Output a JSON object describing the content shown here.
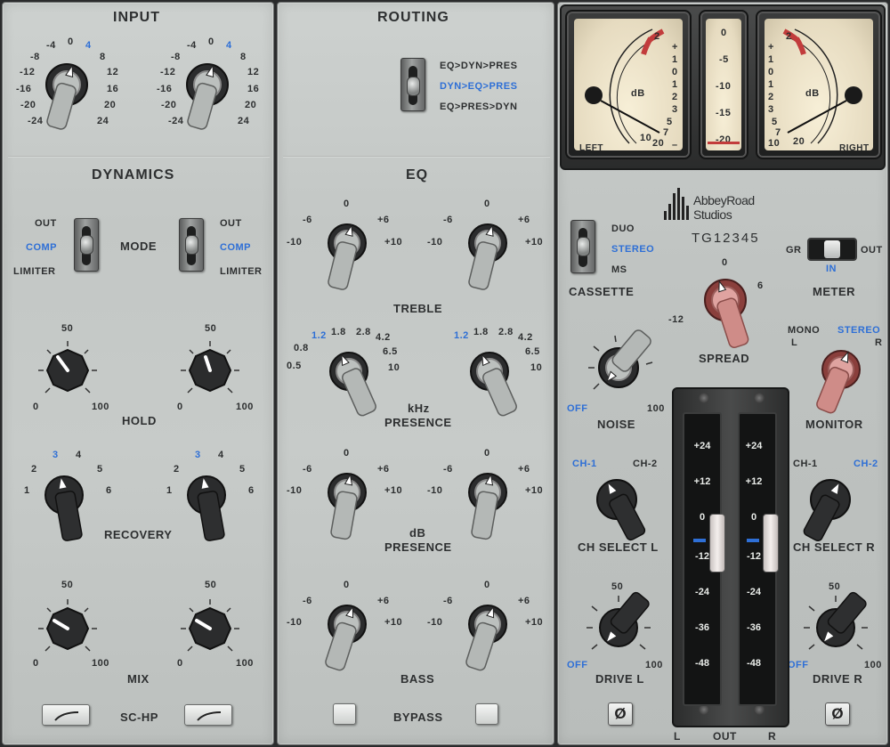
{
  "sections": {
    "input": "INPUT",
    "routing": "ROUTING",
    "dynamics": "DYNAMICS",
    "eq": "EQ"
  },
  "input_scale": {
    "left": [
      "-24",
      "-20",
      "-16",
      "-12",
      "-8",
      "-4",
      "0",
      "4",
      "8",
      "12",
      "16",
      "20",
      "24"
    ],
    "selected": "4"
  },
  "routing": {
    "options": [
      "EQ>DYN>PRES",
      "DYN>EQ>PRES",
      "EQ>PRES>DYN"
    ],
    "selected": "DYN>EQ>PRES"
  },
  "dynamics": {
    "mode_label": "MODE",
    "mode_options": [
      "OUT",
      "COMP",
      "LIMITER"
    ],
    "mode_selected": "COMP",
    "hold_label": "HOLD",
    "hold_scale": [
      "0",
      "50",
      "100"
    ],
    "recovery_label": "RECOVERY",
    "recovery_scale": [
      "1",
      "2",
      "3",
      "4",
      "5",
      "6"
    ],
    "recovery_selected": "3",
    "mix_label": "MIX",
    "mix_scale": [
      "0",
      "50",
      "100"
    ],
    "schp_label": "SC-HP"
  },
  "eq": {
    "treble_label": "TREBLE",
    "gain_scale": [
      "-10",
      "-6",
      "0",
      "+6",
      "+10"
    ],
    "presence_freq_label": "kHz",
    "presence_label": "PRESENCE",
    "freq_scale": [
      "0.5",
      "0.8",
      "1.2",
      "1.8",
      "2.8",
      "4.2",
      "6.5",
      "10"
    ],
    "freq_selected": "1.2",
    "presence_gain_unit": "dB",
    "bass_label": "BASS",
    "bypass_label": "BYPASS"
  },
  "meters": {
    "left_label": "LEFT",
    "right_label": "RIGHT",
    "unit": "dB",
    "vu_scale": [
      "20",
      "10",
      "7",
      "5",
      "3",
      "2",
      "1",
      "0",
      "1",
      "2",
      "3"
    ],
    "vu_plus": "+",
    "vu_minus": "–",
    "center_scale": [
      "0",
      "-5",
      "-10",
      "-15",
      "-20"
    ],
    "brand_line1": "AbbeyRoad",
    "brand_line2": "Studios",
    "model": "TG12345"
  },
  "master": {
    "cassette_label": "CASSETTE",
    "cassette_options": [
      "DUO",
      "STEREO",
      "MS"
    ],
    "cassette_selected": "STEREO",
    "meter_label": "METER",
    "meter_options": [
      "GR",
      "OUT",
      "IN"
    ],
    "meter_selected": "IN",
    "spread_label": "SPREAD",
    "spread_scale": [
      "-12",
      "0",
      "6"
    ],
    "noise_label": "NOISE",
    "noise_scale": [
      "OFF",
      "100"
    ],
    "monitor_label": "MONITOR",
    "monitor_options": [
      "MONO",
      "STEREO",
      "L",
      "R"
    ],
    "monitor_selected": "STEREO",
    "ch_select_l_label": "CH SELECT L",
    "ch_select_r_label": "CH SELECT R",
    "ch_options": [
      "CH-1",
      "CH-2"
    ],
    "ch_l_selected": "CH-1",
    "ch_r_selected": "CH-2",
    "drive_l_label": "DRIVE L",
    "drive_r_label": "DRIVE R",
    "drive_scale": [
      "OFF",
      "50",
      "100"
    ],
    "fader_scale": [
      "+24",
      "+12",
      "0",
      "-12",
      "-24",
      "-36",
      "-48"
    ],
    "out_labels": [
      "L",
      "OUT",
      "R"
    ],
    "phase_symbol": "Ø",
    "fader_left_level_db": 0,
    "fader_right_level_db": 0
  },
  "colors": {
    "accent_blue": "#2e6fd6",
    "panel": "#c7cbc9",
    "knob_black": "#2b2c2d",
    "knob_red": "#c98b87",
    "vu_red": "#c23c3c"
  }
}
